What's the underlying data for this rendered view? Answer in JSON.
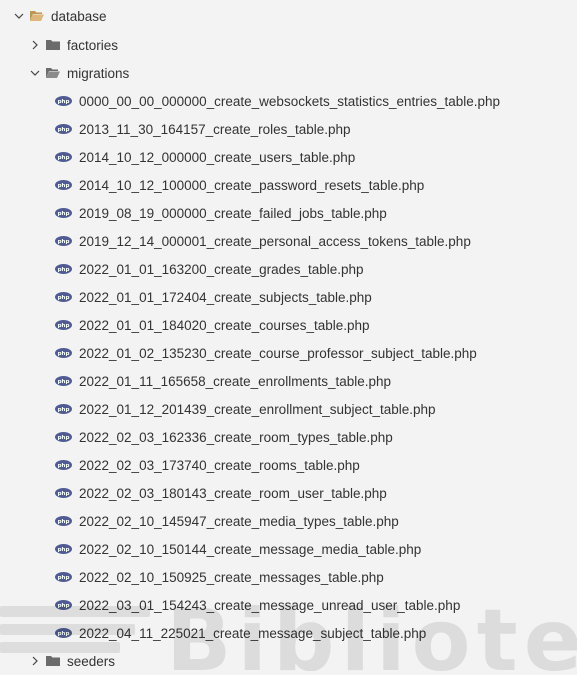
{
  "explorer": {
    "root": {
      "label": "database",
      "expanded": true,
      "icon": "folder-open-icon"
    },
    "folders": [
      {
        "label": "factories",
        "expanded": false,
        "icon": "folder-icon"
      },
      {
        "label": "migrations",
        "expanded": true,
        "icon": "folder-open-icon"
      },
      {
        "label": "seeders",
        "expanded": false,
        "icon": "folder-icon"
      }
    ],
    "migration_files": [
      "0000_00_00_000000_create_websockets_statistics_entries_table.php",
      "2013_11_30_164157_create_roles_table.php",
      "2014_10_12_000000_create_users_table.php",
      "2014_10_12_100000_create_password_resets_table.php",
      "2019_08_19_000000_create_failed_jobs_table.php",
      "2019_12_14_000001_create_personal_access_tokens_table.php",
      "2022_01_01_163200_create_grades_table.php",
      "2022_01_01_172404_create_subjects_table.php",
      "2022_01_01_184020_create_courses_table.php",
      "2022_01_02_135230_create_course_professor_subject_table.php",
      "2022_01_11_165658_create_enrollments_table.php",
      "2022_01_12_201439_create_enrollment_subject_table.php",
      "2022_02_03_162336_create_room_types_table.php",
      "2022_02_03_173740_create_rooms_table.php",
      "2022_02_03_180143_create_room_user_table.php",
      "2022_02_10_145947_create_media_types_table.php",
      "2022_02_10_150144_create_message_media_table.php",
      "2022_02_10_150925_create_messages_table.php",
      "2022_03_01_154243_create_message_unread_user_table.php",
      "2022_04_11_225021_create_message_subject_table.php"
    ],
    "file_icon": "php-icon"
  },
  "watermark": {
    "text": "Bibliotec"
  },
  "colors": {
    "background": "#f3f3f3",
    "text": "#333333",
    "folder_open": "#dcb67a",
    "folder_closed": "#c09553",
    "php_badge": "#4f5b93",
    "chevron": "#424242"
  }
}
